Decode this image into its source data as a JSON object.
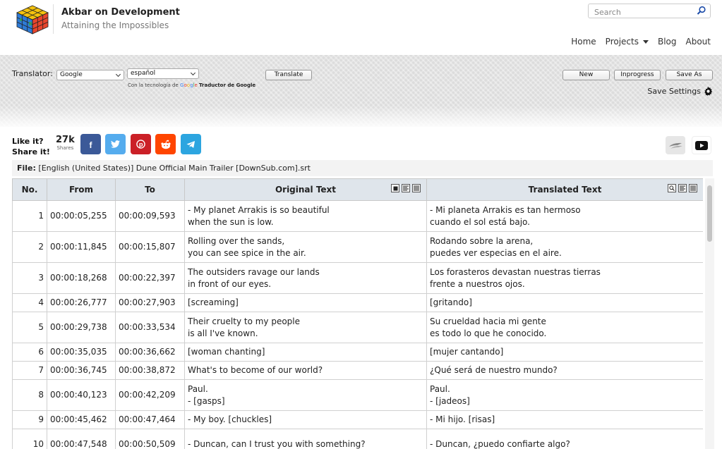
{
  "site": {
    "title": "Akbar on Development",
    "subtitle": "Attaining the Impossibles"
  },
  "search": {
    "placeholder": "Search"
  },
  "nav": {
    "items": [
      {
        "label": "Home"
      },
      {
        "label": "Projects"
      },
      {
        "label": "Blog"
      },
      {
        "label": "About"
      }
    ]
  },
  "toolbar": {
    "translator_label": "Translator:",
    "engine_selected": "Google",
    "language_selected": "español",
    "translate_label": "Translate",
    "powered_prefix": "Con la tecnología de",
    "powered_brand": "Google",
    "powered_suffix": "Traductor de Google",
    "new_label": "New",
    "inprogress_label": "Inprogress",
    "save_as_label": "Save As",
    "save_settings_label": "Save Settings"
  },
  "share": {
    "label_line1": "Like it?",
    "label_line2": "Share it!",
    "count": "27k",
    "count_label": "Shares",
    "colors": {
      "facebook": "#3b5998",
      "twitter": "#55acee",
      "pinterest": "#cb2027",
      "reddit": "#ff4500",
      "telegram": "#2ca5e0"
    }
  },
  "file": {
    "label": "File:",
    "name": "[English (United States)] Dune Official Main Trailer [DownSub.com].srt"
  },
  "table": {
    "headers": {
      "no": "No.",
      "from": "From",
      "to": "To",
      "original": "Original Text",
      "translated": "Translated Text"
    },
    "rows": [
      {
        "no": "1",
        "from": "00:00:05,255",
        "to": "00:00:09,593",
        "original": "- My planet Arrakis is so beautiful\nwhen the sun is low.",
        "translated": "- Mi planeta Arrakis es tan hermoso\ncuando el sol está bajo."
      },
      {
        "no": "2",
        "from": "00:00:11,845",
        "to": "00:00:15,807",
        "original": "Rolling over the sands,\nyou can see spice in the air.",
        "translated": "Rodando sobre la arena,\npuedes ver especias en el aire."
      },
      {
        "no": "3",
        "from": "00:00:18,268",
        "to": "00:00:22,397",
        "original": "The outsiders ravage our lands\nin front of our eyes.",
        "translated": "Los forasteros devastan nuestras tierras\nfrente a nuestros ojos."
      },
      {
        "no": "4",
        "from": "00:00:26,777",
        "to": "00:00:27,903",
        "original": "[screaming]",
        "translated": "[gritando]"
      },
      {
        "no": "5",
        "from": "00:00:29,738",
        "to": "00:00:33,534",
        "original": "Their cruelty to my people\nis all I've known.",
        "translated": "Su crueldad hacia mi gente\nes todo lo que he conocido."
      },
      {
        "no": "6",
        "from": "00:00:35,035",
        "to": "00:00:36,662",
        "original": "[woman chanting]",
        "translated": "[mujer cantando]"
      },
      {
        "no": "7",
        "from": "00:00:36,745",
        "to": "00:00:38,872",
        "original": "What's to become of our world?",
        "translated": "¿Qué será de nuestro mundo?"
      },
      {
        "no": "8",
        "from": "00:00:40,123",
        "to": "00:00:42,209",
        "original": "Paul.\n- [gasps]",
        "translated": "Paul.\n- [jadeos]"
      },
      {
        "no": "9",
        "from": "00:00:45,462",
        "to": "00:00:47,464",
        "original": "- My boy. [chuckles]",
        "translated": "- Mi hijo. [risas]"
      },
      {
        "no": "10",
        "from": "00:00:47,548",
        "to": "00:00:50,509",
        "original": "- Duncan, can I trust you with something?",
        "translated": "- Duncan, ¿puedo confiarte algo?"
      }
    ]
  }
}
